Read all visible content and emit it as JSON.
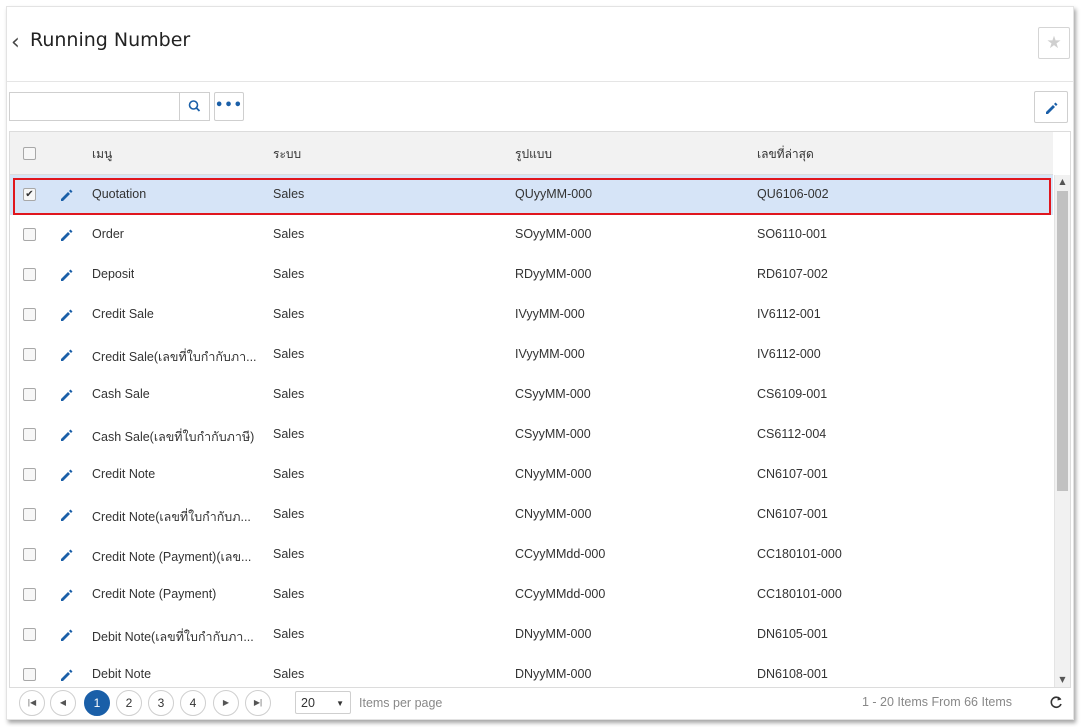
{
  "header": {
    "title": "Running Number",
    "back_icon": "chevron-left-icon",
    "favorite_icon": "star-icon"
  },
  "toolbar": {
    "search_value": "",
    "search_icon": "search-icon",
    "more_label": "•••",
    "edit_icon": "pencil-icon"
  },
  "table": {
    "columns": [
      "เมนู",
      "ระบบ",
      "รูปแบบ",
      "เลขที่ล่าสุด"
    ],
    "rows": [
      {
        "menu": "Quotation",
        "system": "Sales",
        "format": "QUyyMM-000",
        "last": "QU6106-002",
        "checked": true,
        "selected": true
      },
      {
        "menu": "Order",
        "system": "Sales",
        "format": "SOyyMM-000",
        "last": "SO6110-001",
        "checked": false
      },
      {
        "menu": "Deposit",
        "system": "Sales",
        "format": "RDyyMM-000",
        "last": "RD6107-002",
        "checked": false
      },
      {
        "menu": "Credit Sale",
        "system": "Sales",
        "format": "IVyyMM-000",
        "last": "IV6112-001",
        "checked": false
      },
      {
        "menu": "Credit Sale(เลขที่ใบกำกับภา...",
        "system": "Sales",
        "format": "IVyyMM-000",
        "last": "IV6112-000",
        "checked": false
      },
      {
        "menu": "Cash Sale",
        "system": "Sales",
        "format": "CSyyMM-000",
        "last": "CS6109-001",
        "checked": false
      },
      {
        "menu": "Cash Sale(เลขที่ใบกำกับภาษี)",
        "system": "Sales",
        "format": "CSyyMM-000",
        "last": "CS6112-004",
        "checked": false
      },
      {
        "menu": "Credit Note",
        "system": "Sales",
        "format": "CNyyMM-000",
        "last": "CN6107-001",
        "checked": false
      },
      {
        "menu": "Credit Note(เลขที่ใบกำกับภ...",
        "system": "Sales",
        "format": "CNyyMM-000",
        "last": "CN6107-001",
        "checked": false
      },
      {
        "menu": "Credit Note (Payment)(เลข...",
        "system": "Sales",
        "format": "CCyyMMdd-000",
        "last": "CC180101-000",
        "checked": false
      },
      {
        "menu": "Credit Note (Payment)",
        "system": "Sales",
        "format": "CCyyMMdd-000",
        "last": "CC180101-000",
        "checked": false
      },
      {
        "menu": "Debit Note(เลขที่ใบกำกับภา...",
        "system": "Sales",
        "format": "DNyyMM-000",
        "last": "DN6105-001",
        "checked": false
      },
      {
        "menu": "Debit Note",
        "system": "Sales",
        "format": "DNyyMM-000",
        "last": "DN6108-001",
        "checked": false
      }
    ]
  },
  "pager": {
    "first": "|◀",
    "prev": "◀",
    "next": "▶",
    "last": "▶|",
    "pages": [
      "1",
      "2",
      "3",
      "4"
    ],
    "current_page": "1",
    "page_size": "20",
    "page_size_label": "Items per page",
    "info": "1 - 20 Items From 66 Items",
    "refresh_icon": "refresh-icon"
  },
  "colors": {
    "accent": "#1a5fa8",
    "selected_row": "#d6e4f7",
    "highlight_outline": "#e0161e"
  }
}
